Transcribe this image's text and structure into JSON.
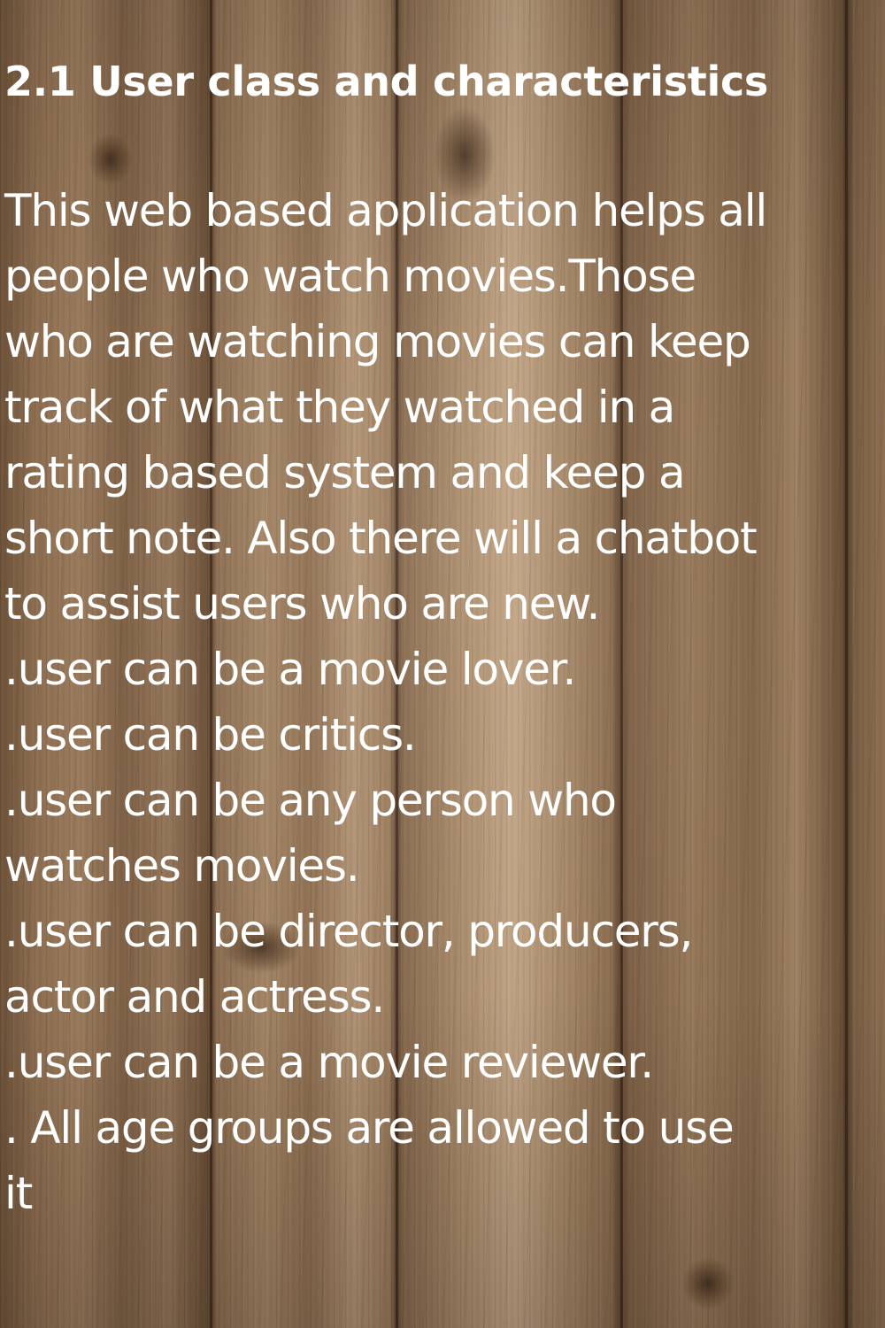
{
  "heading": "2.1 User class and characteristics",
  "lines": [
    "This web based application helps all",
    "people who watch movies.Those",
    "who are watching movies can keep",
    "track of what they watched in a",
    "rating based system and keep a",
    "short note. Also there will a chatbot",
    "to assist users who are new.",
    ".user can be a movie lover.",
    ".user can be critics.",
    ".user can be any person who",
    "watches movies.",
    ".user can be director, producers,",
    "actor and actress.",
    ".user can be a movie reviewer.",
    ". All age groups are allowed to use",
    "it"
  ]
}
